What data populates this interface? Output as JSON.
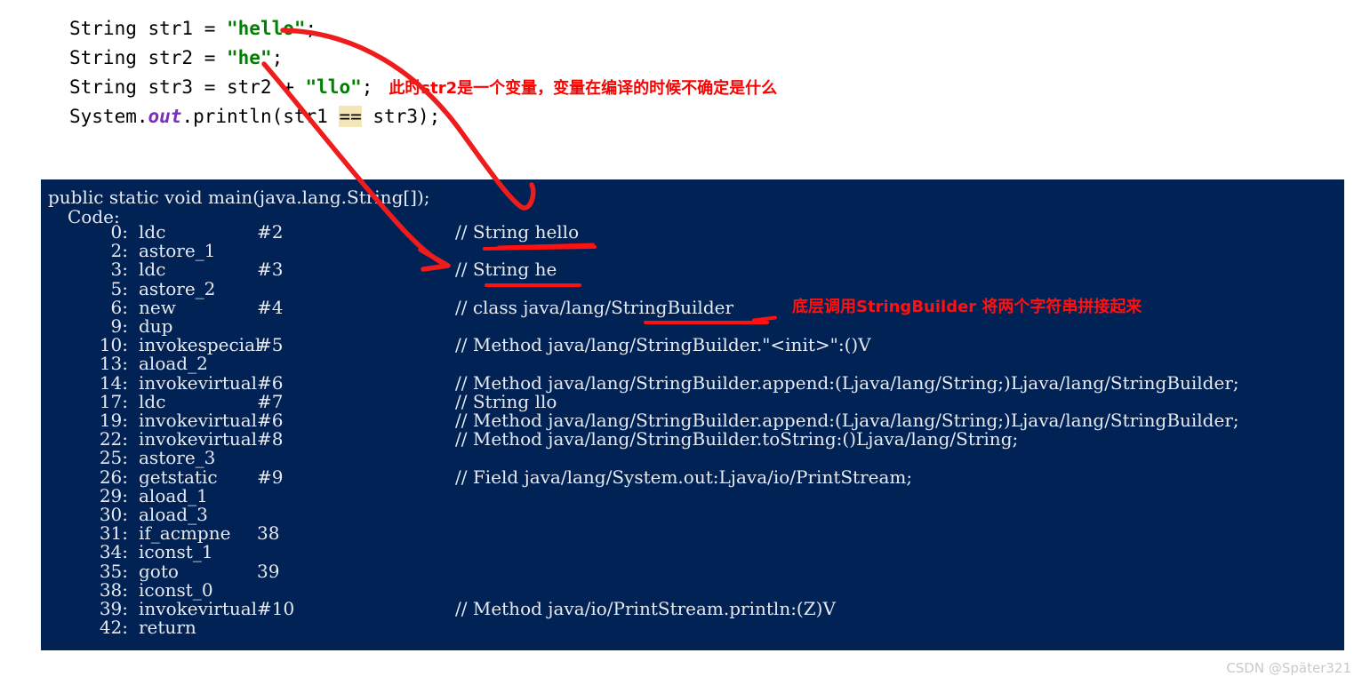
{
  "source_code": {
    "lines": [
      "String str1 = ",
      "String str2 = ",
      "String str3 = str2 + ",
      "System."
    ],
    "line1_prefix": "String str1 = ",
    "line1_string": "\"hello\"",
    "line1_suffix": ";",
    "line2_prefix": "String str2 = ",
    "line2_string": "\"he\"",
    "line2_suffix": ";",
    "line3_prefix": "String str3 = str2 + ",
    "line3_string": "\"llo\"",
    "line3_suffix": ";",
    "line4_a": "System.",
    "line4_field": "out",
    "line4_b": ".println(str1 ",
    "line4_op": "==",
    "line4_c": " str3);"
  },
  "annotations": {
    "note_str2_variable": "此时str2是一个变量，变量在编译的时候不确定是什么",
    "note_stringbuilder": "底层调用StringBuilder 将两个字符串拼接起来"
  },
  "bytecode": {
    "method_signature": "public static void main(java.lang.String[]);",
    "code_label": "Code:",
    "instructions": [
      {
        "addr": "0:",
        "op": "ldc",
        "arg": "#2",
        "comment": "// String hello"
      },
      {
        "addr": "2:",
        "op": "astore_1",
        "arg": "",
        "comment": ""
      },
      {
        "addr": "3:",
        "op": "ldc",
        "arg": "#3",
        "comment": "// String he"
      },
      {
        "addr": "5:",
        "op": "astore_2",
        "arg": "",
        "comment": ""
      },
      {
        "addr": "6:",
        "op": "new",
        "arg": "#4",
        "comment": "// class java/lang/StringBuilder"
      },
      {
        "addr": "9:",
        "op": "dup",
        "arg": "",
        "comment": ""
      },
      {
        "addr": "10:",
        "op": "invokespecial",
        "arg": "#5",
        "comment": "// Method java/lang/StringBuilder.\"<init>\":()V"
      },
      {
        "addr": "13:",
        "op": "aload_2",
        "arg": "",
        "comment": ""
      },
      {
        "addr": "14:",
        "op": "invokevirtual",
        "arg": "#6",
        "comment": "// Method java/lang/StringBuilder.append:(Ljava/lang/String;)Ljava/lang/StringBuilder;"
      },
      {
        "addr": "17:",
        "op": "ldc",
        "arg": "#7",
        "comment": "// String llo"
      },
      {
        "addr": "19:",
        "op": "invokevirtual",
        "arg": "#6",
        "comment": "// Method java/lang/StringBuilder.append:(Ljava/lang/String;)Ljava/lang/StringBuilder;"
      },
      {
        "addr": "22:",
        "op": "invokevirtual",
        "arg": "#8",
        "comment": "// Method java/lang/StringBuilder.toString:()Ljava/lang/String;"
      },
      {
        "addr": "25:",
        "op": "astore_3",
        "arg": "",
        "comment": ""
      },
      {
        "addr": "26:",
        "op": "getstatic",
        "arg": "#9",
        "comment": "// Field java/lang/System.out:Ljava/io/PrintStream;"
      },
      {
        "addr": "29:",
        "op": "aload_1",
        "arg": "",
        "comment": ""
      },
      {
        "addr": "30:",
        "op": "aload_3",
        "arg": "",
        "comment": ""
      },
      {
        "addr": "31:",
        "op": "if_acmpne",
        "arg": "38",
        "comment": ""
      },
      {
        "addr": "34:",
        "op": "iconst_1",
        "arg": "",
        "comment": ""
      },
      {
        "addr": "35:",
        "op": "goto",
        "arg": "39",
        "comment": ""
      },
      {
        "addr": "38:",
        "op": "iconst_0",
        "arg": "",
        "comment": ""
      },
      {
        "addr": "39:",
        "op": "invokevirtual",
        "arg": "#10",
        "comment": "// Method java/io/PrintStream.println:(Z)V"
      },
      {
        "addr": "42:",
        "op": "return",
        "arg": "",
        "comment": ""
      }
    ]
  },
  "watermark": "CSDN @Später321",
  "colors": {
    "panel_background": "#002255",
    "annotation_red": "#ff1111",
    "string_literal_green": "#008000",
    "field_purple": "#7b2fbe",
    "highlight_yellow": "#f5e6b8"
  }
}
